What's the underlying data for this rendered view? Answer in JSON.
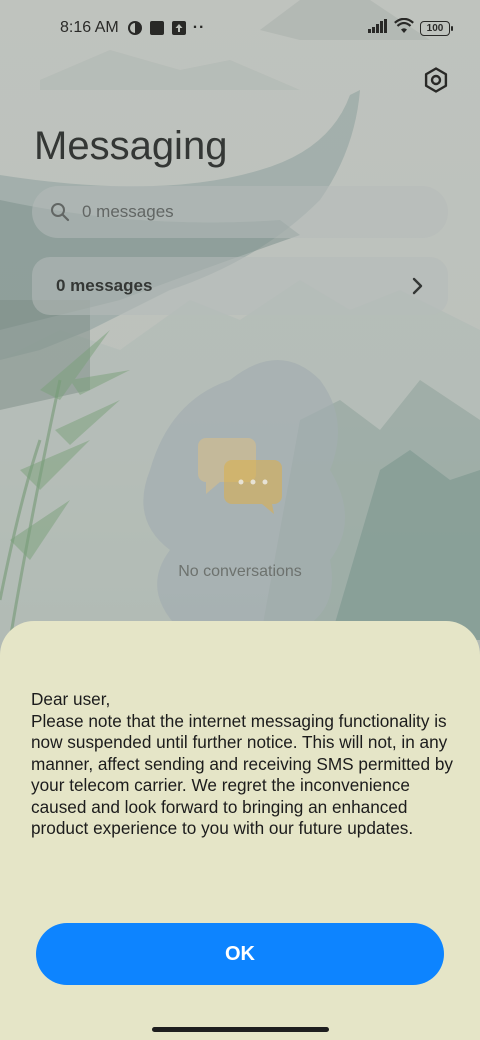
{
  "status_bar": {
    "time": "8:16 AM",
    "battery": "100",
    "more_indicator": "··",
    "icons": [
      "vpn-icon",
      "square-app-icon",
      "upload-notification-icon",
      "signal-icon",
      "wifi-icon",
      "battery-icon"
    ]
  },
  "header": {
    "title": "Messaging",
    "settings_icon": "gear-icon"
  },
  "search": {
    "placeholder": "0 messages"
  },
  "summary": {
    "label": "0 messages"
  },
  "empty_state": {
    "text": "No conversations"
  },
  "dialog": {
    "greeting": "Dear user,",
    "body": "Please note that the internet messaging functionality is now suspended until further notice. This will not, in any manner, affect sending and receiving SMS permitted by your telecom carrier. We regret the inconvenience caused and look forward to bringing an enhanced product experience to you with our future updates.",
    "ok_label": "OK"
  },
  "colors": {
    "accent": "#0d84ff",
    "dialog_background": "#e5e5c7"
  }
}
